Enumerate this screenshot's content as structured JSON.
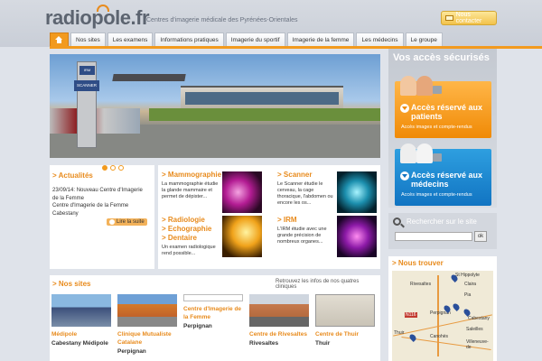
{
  "header": {
    "logo": "radiopole.fr",
    "tagline": "Centres d'imagerie médicale des Pyrénées-Orientales",
    "contact_label": "Nous contacter"
  },
  "nav": {
    "tabs": [
      "Nos sites",
      "Les examens",
      "Informations pratiques",
      "Imagerie du sportif",
      "Imagerie de la femme",
      "Les médecins",
      "Le groupe"
    ]
  },
  "banner": {
    "sign_top": "IRM",
    "sign_scanner": "SCANNER"
  },
  "news": {
    "title": "Actualités",
    "text": "23/09/14: Nouveau Centre d'Imagerie de la Femme",
    "text2": "Centre d'Imagerie de la Femme Cabestany",
    "more_label": "Lire la suite"
  },
  "specialties": {
    "mammo_title": "Mammographie",
    "mammo_desc": "La mammographie étudie la glande mammaire et permet de dépister...",
    "scanner_title": "Scanner",
    "scanner_desc": "Le Scanner étudie le cerveau, la cage thoracique, l'abdomen ou encore les os...",
    "radio_titles": [
      "Radiologie",
      "Echographie",
      "Dentaire"
    ],
    "radio_desc": "Un examen radiologique rend possible...",
    "irm_title": "IRM",
    "irm_desc": "L'IRM étudie avec une grande précision de nombreux organes..."
  },
  "access": {
    "title": "Vos accès sécurisés",
    "patients_title": "Accès réservé aux patients",
    "patients_sub": "Accès images et compte-rendus",
    "medecins_title": "Accès réservé aux médecins",
    "medecins_sub": "Accès images et compte-rendus"
  },
  "search": {
    "label": "Rechercher sur le site",
    "placeholder": "",
    "ok": "ok"
  },
  "find": {
    "title": "Nous trouver",
    "places": [
      "St Hippolyte",
      "Rivesaltes",
      "Claira",
      "Pia",
      "Perpignan",
      "Cabestany",
      "Thuir",
      "Canohès",
      "Saleilles",
      "Villeneuve-de",
      "N116"
    ]
  },
  "sites": {
    "title": "Nos sites",
    "hint": "Retrouvez les infos de nos quatres cliniques",
    "items": [
      {
        "name": "Médipole",
        "sub": "Cabestany Médipole"
      },
      {
        "name": "Clinique Mutualiste Catalane",
        "sub": "Perpignan"
      },
      {
        "name": "Centre d'Imagerie de la Femme",
        "sub": "Perpignan"
      },
      {
        "name": "Centre de Rivesaltes",
        "sub": "Rivesaltes"
      },
      {
        "name": "Centre de Thuir",
        "sub": "Thuir"
      }
    ]
  },
  "colors": {
    "accent": "#f29a1e",
    "patients": "#f08a06",
    "medecins": "#1174c2"
  }
}
